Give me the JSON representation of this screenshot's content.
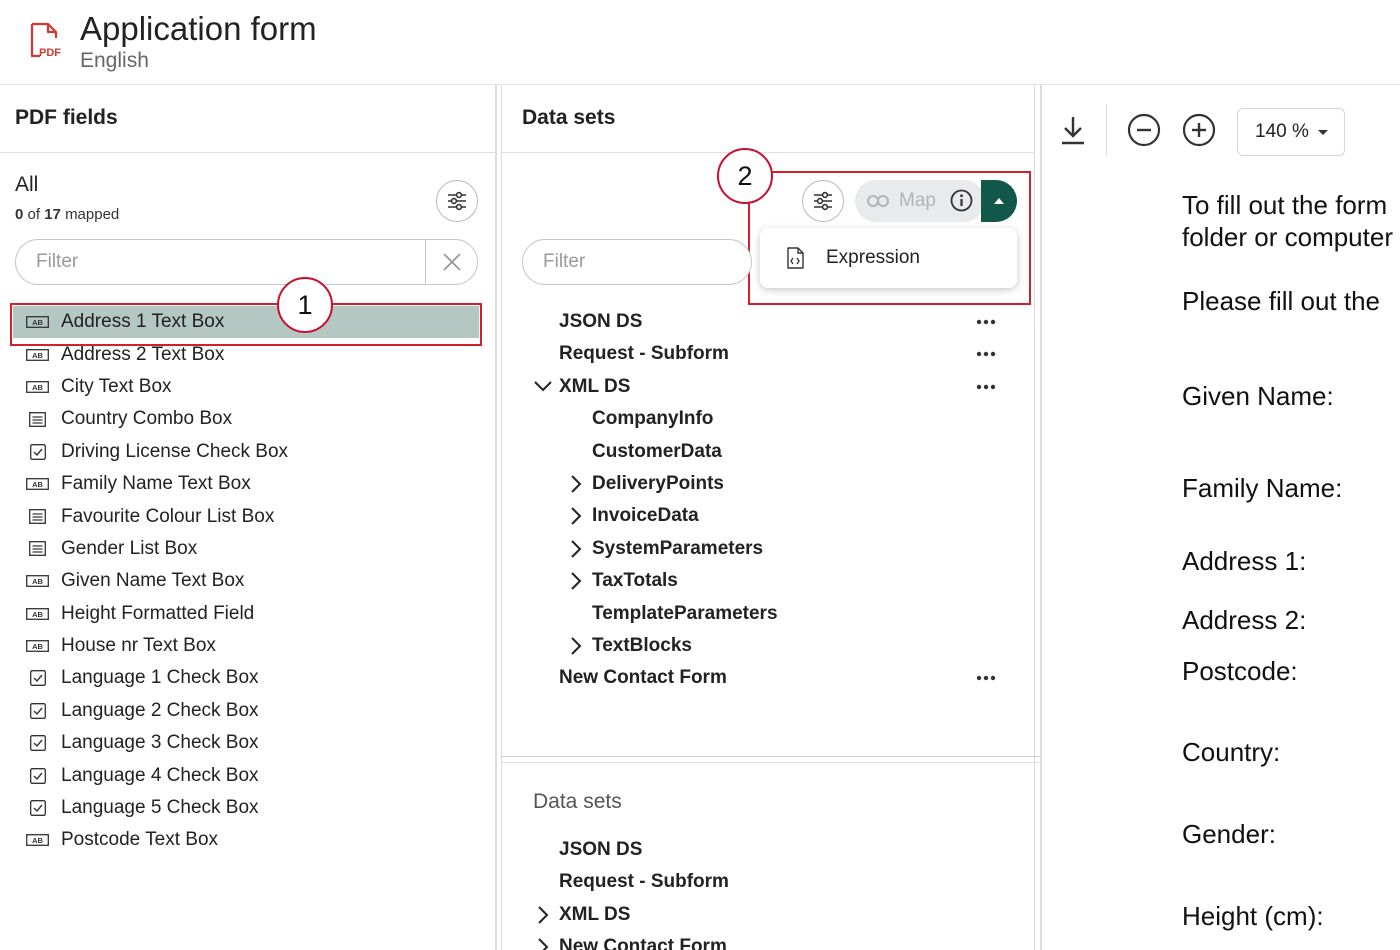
{
  "app": {
    "title": "Application form",
    "subtitle": "English"
  },
  "left_panel": {
    "title": "PDF fields",
    "group_label": "All",
    "mapped": {
      "count": "0",
      "of_word": "of",
      "total": "17",
      "suffix": "mapped"
    },
    "filter_placeholder": "Filter",
    "fields": [
      {
        "label": "Address 1 Text Box",
        "icon": "text-box-icon",
        "selected": true
      },
      {
        "label": "Address 2 Text Box",
        "icon": "text-box-icon"
      },
      {
        "label": "City Text Box",
        "icon": "text-box-icon"
      },
      {
        "label": "Country Combo Box",
        "icon": "list-box-icon"
      },
      {
        "label": "Driving License Check Box",
        "icon": "check-box-icon"
      },
      {
        "label": "Family Name Text Box",
        "icon": "text-box-icon"
      },
      {
        "label": "Favourite Colour List Box",
        "icon": "list-box-icon"
      },
      {
        "label": "Gender List Box",
        "icon": "list-box-icon"
      },
      {
        "label": "Given Name Text Box",
        "icon": "text-box-icon"
      },
      {
        "label": "Height Formatted Field",
        "icon": "text-box-icon"
      },
      {
        "label": "House nr Text Box",
        "icon": "text-box-icon"
      },
      {
        "label": "Language 1 Check Box",
        "icon": "check-box-icon"
      },
      {
        "label": "Language 2 Check Box",
        "icon": "check-box-icon"
      },
      {
        "label": "Language 3 Check Box",
        "icon": "check-box-icon"
      },
      {
        "label": "Language 4 Check Box",
        "icon": "check-box-icon"
      },
      {
        "label": "Language 5 Check Box",
        "icon": "check-box-icon"
      },
      {
        "label": "Postcode Text Box",
        "icon": "text-box-icon"
      }
    ]
  },
  "middle_panel": {
    "title": "Data sets",
    "filter_placeholder": "Filter",
    "map_button_label": "Map",
    "dropdown_items": [
      {
        "label": "Expression",
        "icon": "expression-file-icon"
      }
    ],
    "tree": [
      {
        "label": "JSON DS",
        "more": true
      },
      {
        "label": "Request - Subform",
        "more": true
      },
      {
        "label": "XML DS",
        "expanded": true,
        "more": true
      },
      {
        "label": "CompanyInfo",
        "level": 1
      },
      {
        "label": "CustomerData",
        "level": 1
      },
      {
        "label": "DeliveryPoints",
        "level": 1,
        "expandable": true
      },
      {
        "label": "InvoiceData",
        "level": 1,
        "expandable": true
      },
      {
        "label": "SystemParameters",
        "level": 1,
        "expandable": true
      },
      {
        "label": "TaxTotals",
        "level": 1,
        "expandable": true
      },
      {
        "label": "TemplateParameters",
        "level": 1
      },
      {
        "label": "TextBlocks",
        "level": 1,
        "expandable": true
      },
      {
        "label": "New Contact Form",
        "more": true
      }
    ],
    "lower_title": "Data sets",
    "lower_tree": [
      {
        "label": "JSON DS"
      },
      {
        "label": "Request - Subform"
      },
      {
        "label": "XML DS",
        "expandable": true
      },
      {
        "label": "New Contact Form",
        "expandable": true
      }
    ]
  },
  "preview": {
    "zoom": "140 %",
    "lines": [
      "To fill out the form",
      "folder or computer",
      "Please fill out the",
      "Given Name:",
      "Family Name:",
      "Address 1:",
      "Address 2:",
      "Postcode:",
      "Country:",
      "Gender:",
      "Height (cm):"
    ]
  },
  "callouts": {
    "one": "1",
    "two": "2"
  },
  "colors": {
    "selected_row": "#b5c7c2",
    "accent_button": "#11584a",
    "callout_red": "#d3202b",
    "pdf_icon": "#d9352f"
  }
}
